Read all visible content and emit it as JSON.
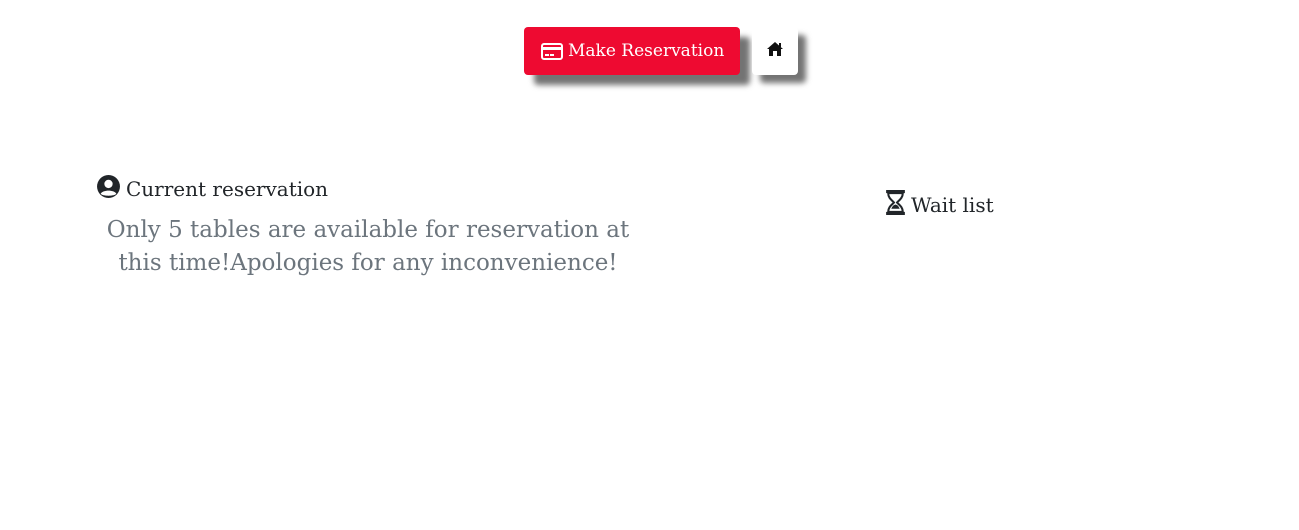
{
  "header": {
    "reserve_label": "Make Reservation",
    "reserve_icon": "credit-card-icon",
    "home_icon": "home-icon"
  },
  "current": {
    "title": "Current reservation",
    "icon": "user-circle-icon",
    "notice": "Only 5 tables are available for reservation at this time!Apologies for any inconvenience!"
  },
  "waitlist": {
    "title": "Wait list",
    "icon": "hourglass-icon"
  },
  "colors": {
    "accent": "#ee0a31",
    "text": "#212529",
    "muted": "#6c757d"
  }
}
